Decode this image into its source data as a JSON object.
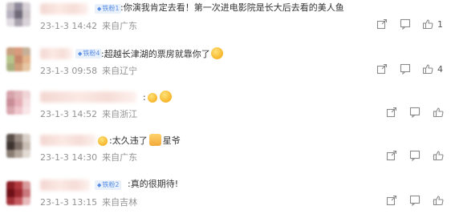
{
  "comments": [
    {
      "badge": "铁粉1",
      "segments": [
        ":你演我肯定去看！第一次进电影院是长大后去看的美人鱼"
      ],
      "time": "23-1-3 14:42",
      "source": "来自广东",
      "likes": "1"
    },
    {
      "badge": "铁粉4",
      "segments": [
        ":超越长津湖的票房就靠你了"
      ],
      "emoji_after": "dog-face",
      "time": "23-1-3 09:58",
      "source": "来自辽宁",
      "likes": "4"
    },
    {
      "badge": "",
      "segments": [
        ":"
      ],
      "emoji_after": "hands-face",
      "time": "23-1-3 14:52",
      "source": "来自浙江",
      "likes": ""
    },
    {
      "badge": "",
      "segments": [
        ":太久违了",
        "星爷"
      ],
      "emoji_after": "thumbs-up",
      "time": "23-1-3 14:30",
      "source": "来自广东",
      "likes": ""
    },
    {
      "badge": "铁粉2",
      "segments": [
        ":真的很期待!"
      ],
      "time": "23-1-3 13:15",
      "source": "来自吉林",
      "likes": ""
    }
  ],
  "icons": {
    "share": "share-icon",
    "comment": "comment-icon",
    "like": "thumbs-up-icon",
    "badge": "diamond-icon"
  },
  "colors": {
    "badge_bg": "#e8f0fc",
    "badge_text": "#5a8ee6",
    "meta_text": "#939393",
    "body_text": "#333333"
  }
}
